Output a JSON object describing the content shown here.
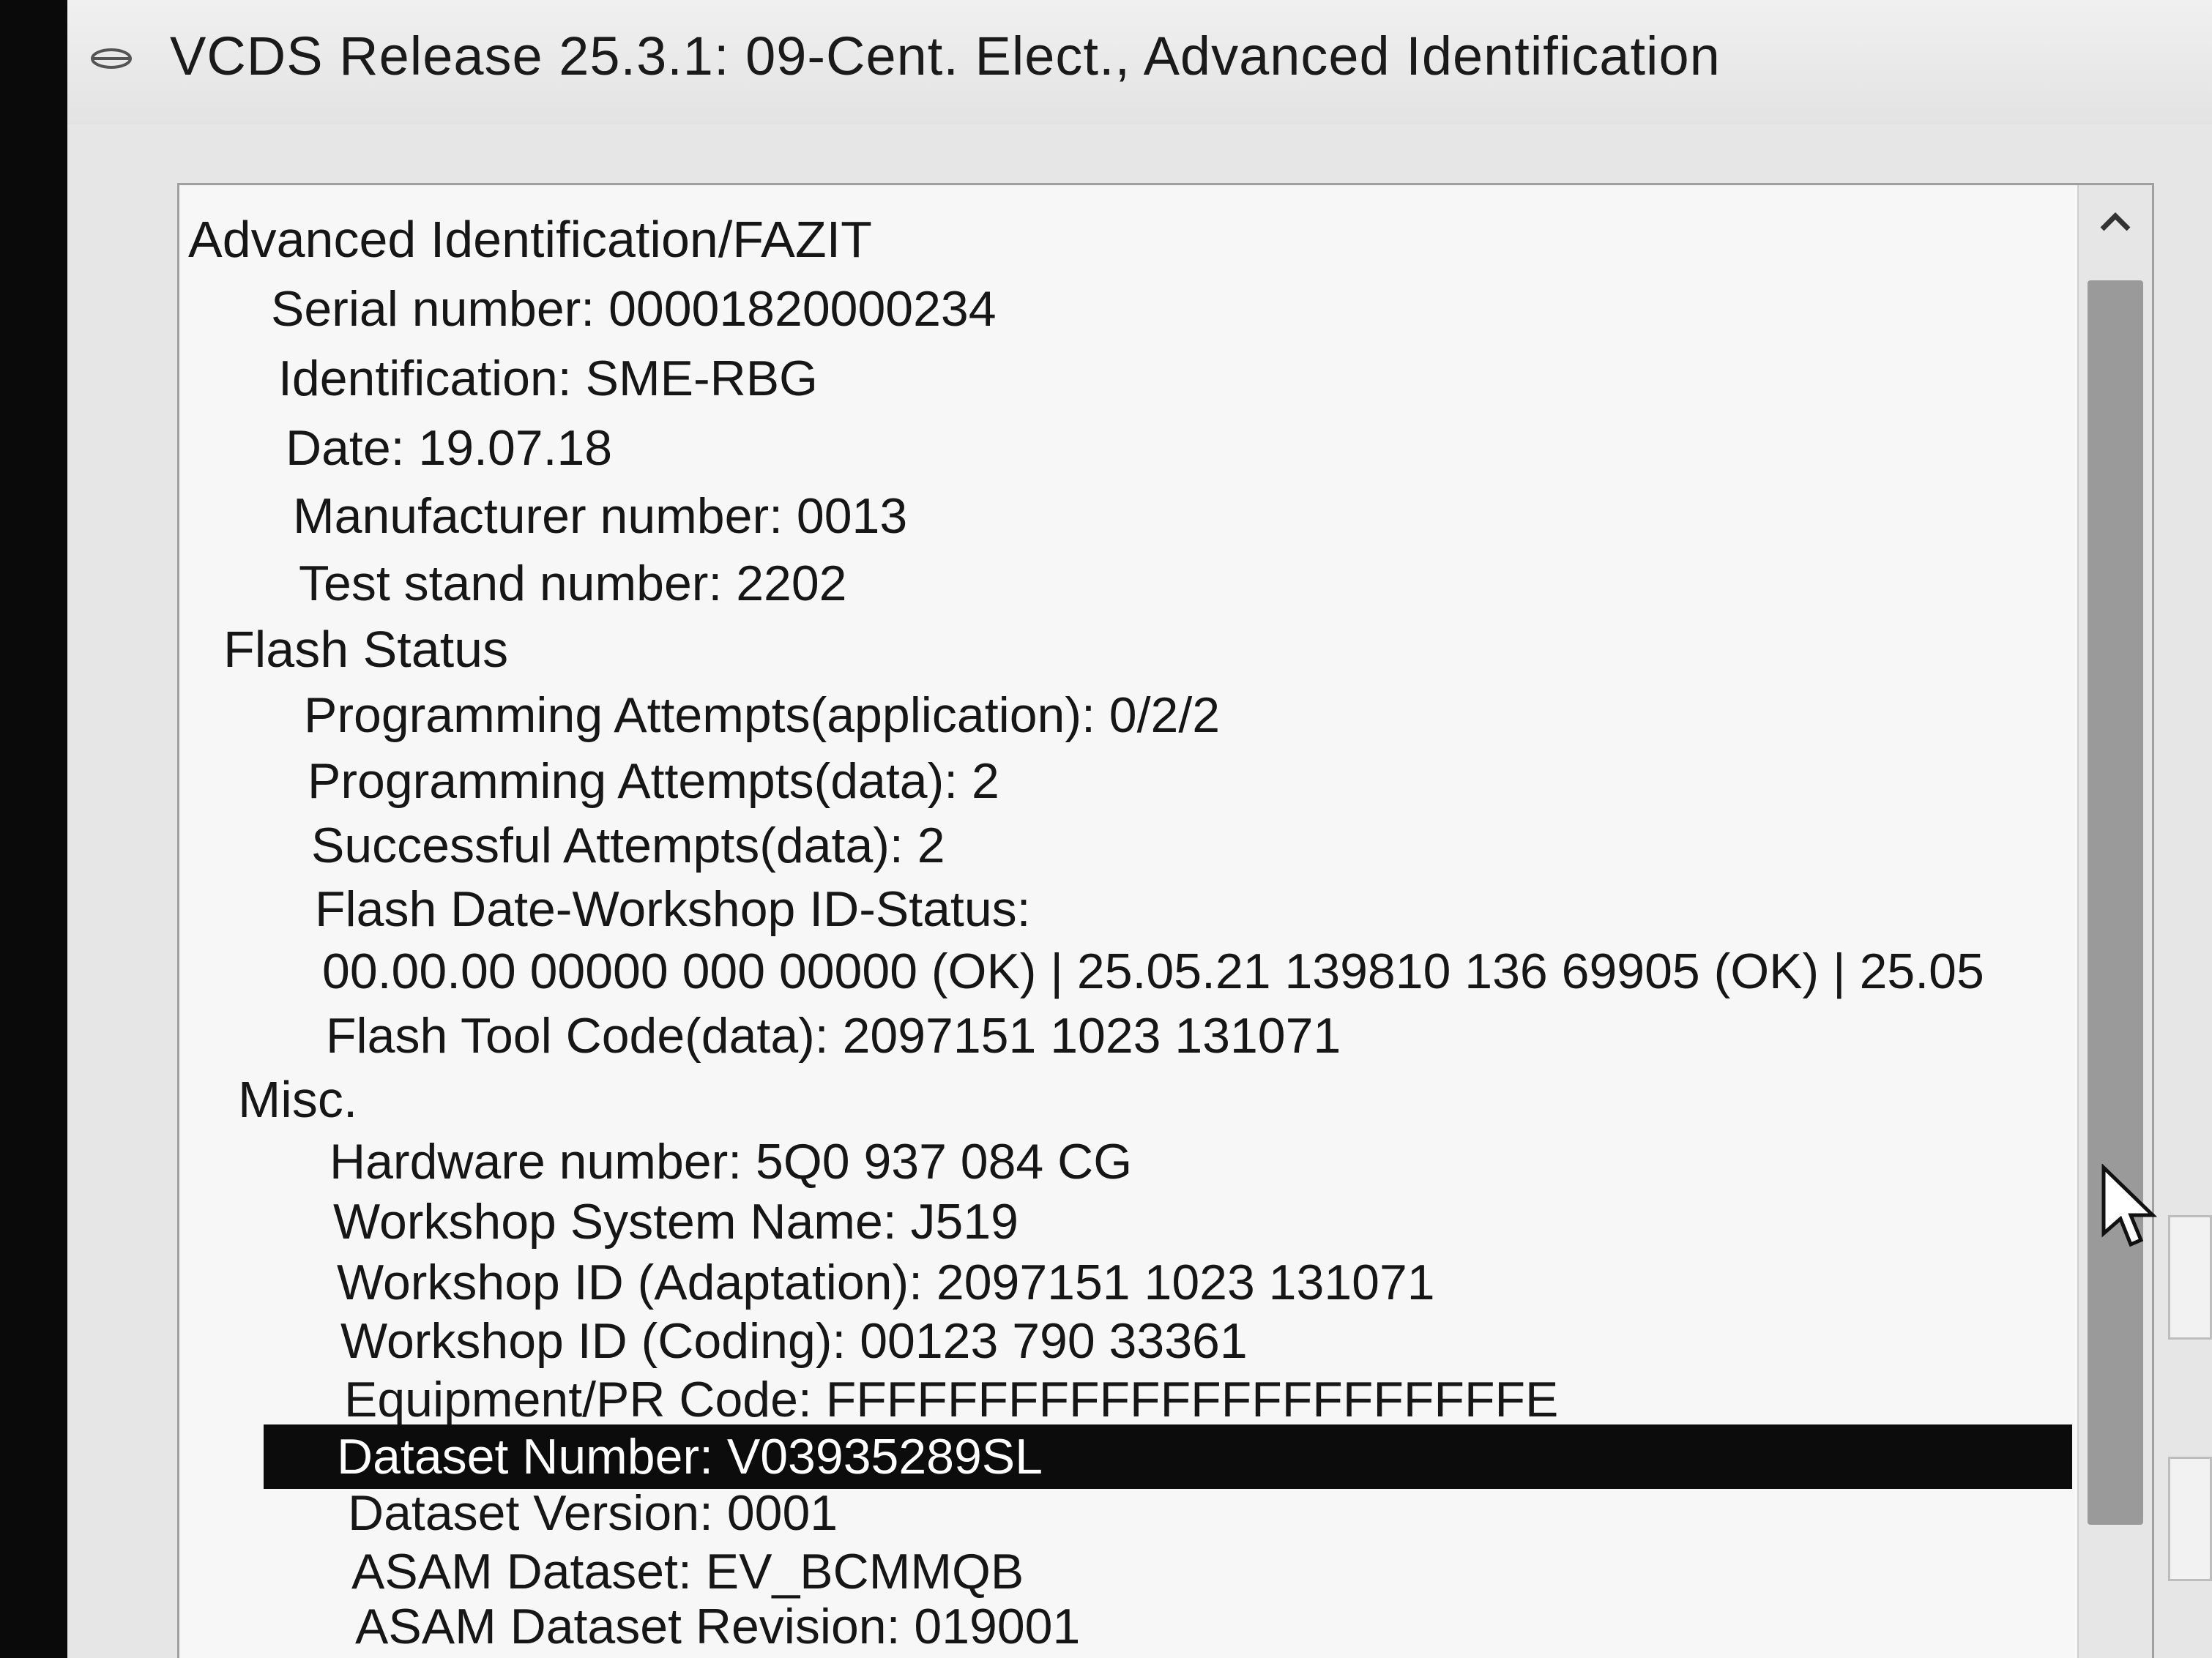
{
  "window": {
    "title": "VCDS Release 25.3.1: 09-Cent. Elect.,  Advanced Identification"
  },
  "icons": {
    "app": "vcds-cable-icon",
    "scroll_up": "chevron-up-icon",
    "cursor": "mouse-pointer-icon"
  },
  "colors": {
    "selection_bg": "#0c0c0c",
    "selection_fg": "#ffffff",
    "list_bg": "#f7f7f7",
    "scroll_thumb": "#9a9a9a"
  },
  "list": {
    "rows": [
      {
        "text": "Advanced Identification/FAZIT",
        "section": true
      },
      {
        "text": "Serial number: 00001820000234"
      },
      {
        "text": "Identification: SME-RBG"
      },
      {
        "text": "Date: 19.07.18"
      },
      {
        "text": "Manufacturer number: 0013"
      },
      {
        "text": "Test stand number: 2202"
      },
      {
        "text": "Flash Status",
        "section": true
      },
      {
        "text": "Programming Attempts(application): 0/2/2"
      },
      {
        "text": "Programming Attempts(data): 2"
      },
      {
        "text": "Successful Attempts(data): 2"
      },
      {
        "text": "Flash Date-Workshop ID-Status:"
      },
      {
        "text": "00.00.00 00000 000 00000 (OK) | 25.05.21 139810 136 69905 (OK) | 25.05"
      },
      {
        "text": "Flash Tool Code(data): 2097151 1023 131071"
      },
      {
        "text": "Misc.",
        "section": true
      },
      {
        "text": "Hardware number: 5Q0 937 084 CG"
      },
      {
        "text": "Workshop System Name: J519"
      },
      {
        "text": "Workshop ID (Adaptation): 2097151 1023 131071"
      },
      {
        "text": "Workshop ID (Coding): 00123 790 33361"
      },
      {
        "text": "Equipment/PR Code: FFFFFFFFFFFFFFFFFFFFFFFE"
      },
      {
        "text": "Dataset Number: V03935289SL",
        "selected": true
      },
      {
        "text": "Dataset Version: 0001"
      },
      {
        "text": "ASAM Dataset: EV_BCMMQB"
      },
      {
        "text": "ASAM Dataset Revision: 019001"
      }
    ]
  }
}
